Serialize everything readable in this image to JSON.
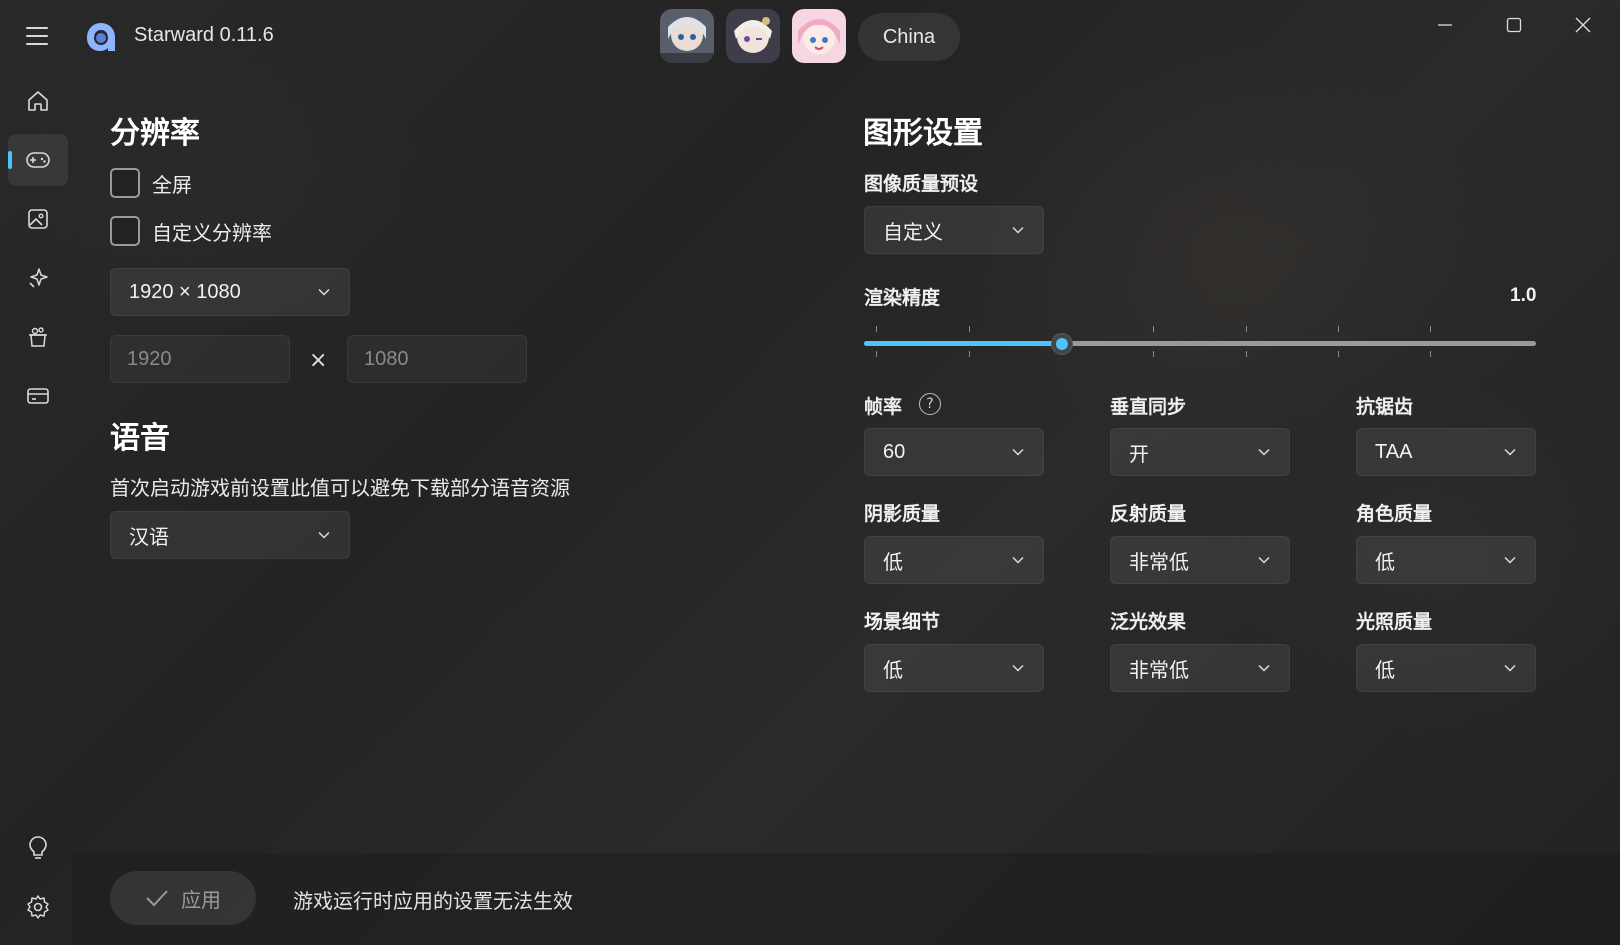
{
  "app": {
    "title": "Starward 0.11.6",
    "region": "China"
  },
  "colors": {
    "accent": "#4cc2ff",
    "background": "#262525"
  },
  "titlebar": {
    "menu_icon": "hamburger-icon",
    "games": [
      "avatar-game-1",
      "avatar-game-2",
      "avatar-game-3"
    ],
    "window_controls": [
      "minimize-icon",
      "maximize-icon",
      "close-icon"
    ]
  },
  "sidebar": {
    "items": [
      {
        "icon": "home-icon",
        "active": false
      },
      {
        "icon": "gamepad-icon",
        "active": true
      },
      {
        "icon": "image-icon",
        "active": false
      },
      {
        "icon": "sparkle-icon",
        "active": false
      },
      {
        "icon": "gacha-icon",
        "active": false
      },
      {
        "icon": "card-icon",
        "active": false
      }
    ],
    "bottom_items": [
      {
        "icon": "lightbulb-icon"
      },
      {
        "icon": "settings-icon"
      }
    ]
  },
  "resolution": {
    "heading": "分辨率",
    "fullscreen_label": "全屏",
    "custom_label": "自定义分辨率",
    "preset": "1920 × 1080",
    "width_placeholder": "1920",
    "height_placeholder": "1080",
    "times": "×"
  },
  "voice": {
    "heading": "语音",
    "description": "首次启动游戏前设置此值可以避免下载部分语音资源",
    "language": "汉语"
  },
  "graphics": {
    "heading": "图形设置",
    "preset_label": "图像质量预设",
    "preset_value": "自定义",
    "render_label": "渲染精度",
    "render_value": "1.0",
    "render_fraction": 0.294,
    "fps_label": "帧率",
    "fps_value": "60",
    "vsync_label": "垂直同步",
    "vsync_value": "开",
    "aa_label": "抗锯齿",
    "aa_value": "TAA",
    "shadow_label": "阴影质量",
    "shadow_value": "低",
    "reflection_label": "反射质量",
    "reflection_value": "非常低",
    "character_label": "角色质量",
    "character_value": "低",
    "scene_label": "场景细节",
    "scene_value": "低",
    "bloom_label": "泛光效果",
    "bloom_value": "非常低",
    "lighting_label": "光照质量",
    "lighting_value": "低"
  },
  "footer": {
    "apply_label": "应用",
    "note": "游戏运行时应用的设置无法生效"
  }
}
